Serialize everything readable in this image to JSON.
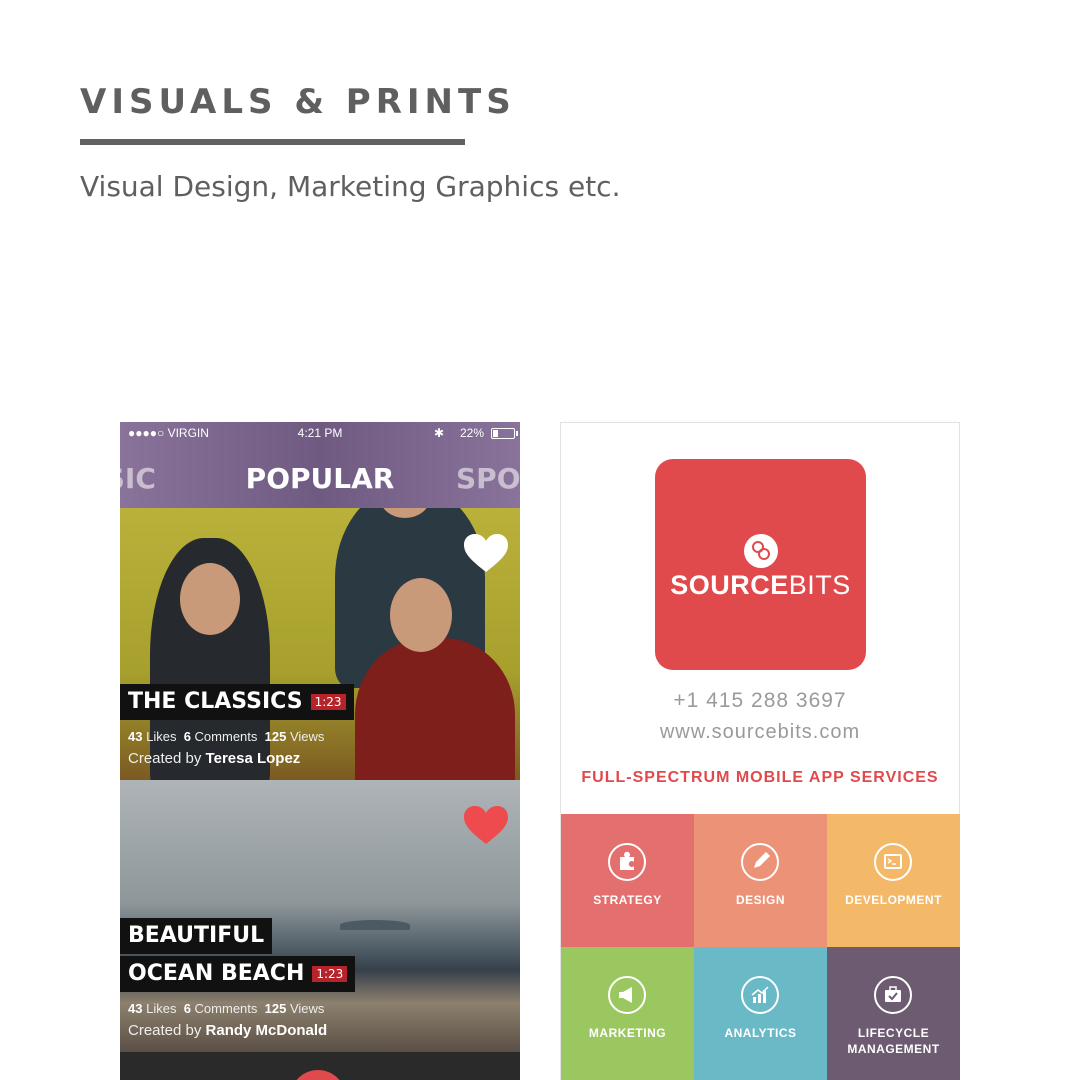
{
  "section": {
    "title": "VISUALS & PRINTS",
    "subtitle": "Visual Design, Marketing Graphics etc."
  },
  "phone_mockup": {
    "status": {
      "carrier": "●●●●○ VIRGIN",
      "time": "4:21 PM",
      "battery": "22%"
    },
    "tabs": {
      "left": "USIC",
      "active": "POPULAR",
      "right": "SPO"
    },
    "cards": [
      {
        "title": "THE CLASSICS",
        "duration": "1:23",
        "likes": "43",
        "likes_label": "Likes",
        "comments": "6",
        "comments_label": "Comments",
        "views": "125",
        "views_label": "Views",
        "created_by_label": "Created by",
        "creator": "Teresa Lopez",
        "heart_color": "#ffffff"
      },
      {
        "title_line1": "BEAUTIFUL",
        "title_line2": "OCEAN BEACH",
        "duration": "1:23",
        "likes": "43",
        "likes_label": "Likes",
        "comments": "6",
        "comments_label": "Comments",
        "views": "125",
        "views_label": "Views",
        "created_by_label": "Created by",
        "creator": "Randy McDonald",
        "heart_color": "#ee4b4f"
      }
    ]
  },
  "business_card": {
    "brand_part1": "SOURCE",
    "brand_part2": "BITS",
    "brand_color": "#e04a4c",
    "phone": "+1 415 288 3697",
    "website": "www.sourcebits.com",
    "tagline": "FULL-SPECTRUM MOBILE APP SERVICES",
    "services": [
      {
        "label": "STRATEGY",
        "icon": "puzzle-icon",
        "color": "#e3706e"
      },
      {
        "label": "DESIGN",
        "icon": "pencil-icon",
        "color": "#ec9277"
      },
      {
        "label": "DEVELOPMENT",
        "icon": "terminal-icon",
        "color": "#f3b868"
      },
      {
        "label": "MARKETING",
        "icon": "megaphone-icon",
        "color": "#9bc760"
      },
      {
        "label": "ANALYTICS",
        "icon": "chart-icon",
        "color": "#6ab9c6"
      },
      {
        "label": "LIFECYCLE MANAGEMENT",
        "icon": "briefcase-icon",
        "color": "#6c5b71"
      }
    ]
  }
}
